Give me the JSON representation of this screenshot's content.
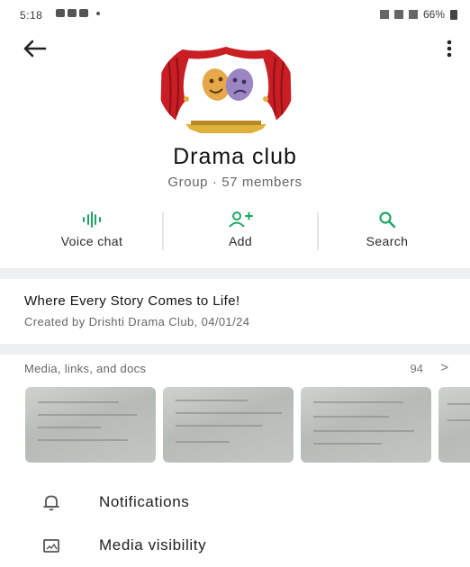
{
  "status_bar": {
    "time": "5:18",
    "battery": "66%"
  },
  "group": {
    "name": "Drama club",
    "subtitle": "Group · 57 members"
  },
  "actions": [
    {
      "label": "Voice chat",
      "icon": "voice-waveform-icon"
    },
    {
      "label": "Add",
      "icon": "add-person-icon"
    },
    {
      "label": "Search",
      "icon": "search-icon"
    }
  ],
  "description": {
    "title": "Where Every Story Comes to Life!",
    "created": "Created by Drishti Drama Club, 04/01/24"
  },
  "media": {
    "label": "Media, links, and docs",
    "count": "94",
    "chevron": ">"
  },
  "menu": [
    {
      "label": "Notifications",
      "icon": "bell-icon"
    },
    {
      "label": "Media visibility",
      "icon": "image-icon"
    }
  ],
  "colors": {
    "accent": "#1fa463",
    "curtain": "#c81e24",
    "separator": "#eef0f1"
  }
}
